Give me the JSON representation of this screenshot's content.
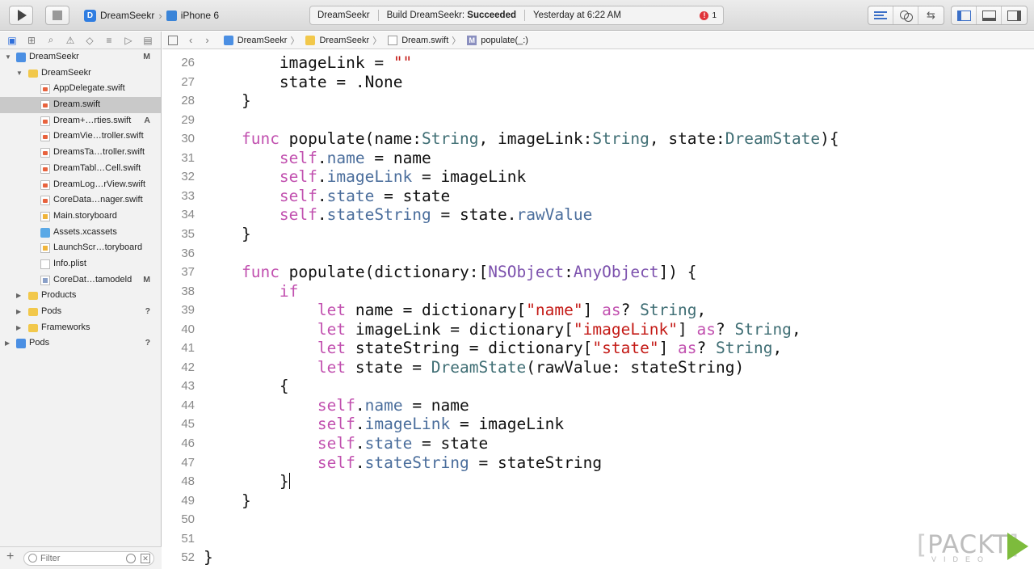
{
  "toolbar": {
    "scheme": {
      "app_icon": "D",
      "app": "DreamSeekr",
      "device": "iPhone 6"
    },
    "activity": {
      "project": "DreamSeekr",
      "build_label": "Build DreamSeekr:",
      "build_status": "Succeeded",
      "time": "Yesterday at 6:22 AM",
      "issues": "1"
    }
  },
  "navigator": {
    "tree": [
      {
        "label": "DreamSeekr",
        "badge": "M"
      },
      {
        "label": "DreamSeekr",
        "badge": ""
      },
      {
        "label": "AppDelegate.swift",
        "badge": ""
      },
      {
        "label": "Dream.swift",
        "badge": ""
      },
      {
        "label": "Dream+…rties.swift",
        "badge": "A"
      },
      {
        "label": "DreamVie…troller.swift",
        "badge": ""
      },
      {
        "label": "DreamsTa…troller.swift",
        "badge": ""
      },
      {
        "label": "DreamTabl…Cell.swift",
        "badge": ""
      },
      {
        "label": "DreamLog…rView.swift",
        "badge": ""
      },
      {
        "label": "CoreData…nager.swift",
        "badge": ""
      },
      {
        "label": "Main.storyboard",
        "badge": ""
      },
      {
        "label": "Assets.xcassets",
        "badge": ""
      },
      {
        "label": "LaunchScr…toryboard",
        "badge": ""
      },
      {
        "label": "Info.plist",
        "badge": ""
      },
      {
        "label": "CoreDat…tamodeld",
        "badge": "M"
      },
      {
        "label": "Products",
        "badge": ""
      },
      {
        "label": "Pods",
        "badge": "?"
      },
      {
        "label": "Frameworks",
        "badge": ""
      },
      {
        "label": "Pods",
        "badge": "?"
      }
    ],
    "filter_placeholder": "Filter"
  },
  "jumpbar": {
    "crumbs": [
      "DreamSeekr",
      "DreamSeekr",
      "Dream.swift",
      "populate(_:)"
    ],
    "method_icon": "M"
  },
  "editor": {
    "lines": [
      {
        "n": "26",
        "code": "        imageLink = \"\""
      },
      {
        "n": "27",
        "code": "        state = .None"
      },
      {
        "n": "28",
        "code": "    }"
      },
      {
        "n": "29",
        "code": ""
      },
      {
        "n": "30",
        "code": "    func populate(name:String, imageLink:String, state:DreamState){"
      },
      {
        "n": "31",
        "code": "        self.name = name"
      },
      {
        "n": "32",
        "code": "        self.imageLink = imageLink"
      },
      {
        "n": "33",
        "code": "        self.state = state"
      },
      {
        "n": "34",
        "code": "        self.stateString = state.rawValue"
      },
      {
        "n": "35",
        "code": "    }"
      },
      {
        "n": "36",
        "code": ""
      },
      {
        "n": "37",
        "code": "    func populate(dictionary:[NSObject:AnyObject]) {"
      },
      {
        "n": "38",
        "code": "        if"
      },
      {
        "n": "39",
        "code": "            let name = dictionary[\"name\"] as? String,"
      },
      {
        "n": "40",
        "code": "            let imageLink = dictionary[\"imageLink\"] as? String,"
      },
      {
        "n": "41",
        "code": "            let stateString = dictionary[\"state\"] as? String,"
      },
      {
        "n": "42",
        "code": "            let state = DreamState(rawValue: stateString)"
      },
      {
        "n": "43",
        "code": "        {"
      },
      {
        "n": "44",
        "code": "            self.name = name"
      },
      {
        "n": "45",
        "code": "            self.imageLink = imageLink"
      },
      {
        "n": "46",
        "code": "            self.state = state"
      },
      {
        "n": "47",
        "code": "            self.stateString = stateString"
      },
      {
        "n": "48",
        "code": "        }"
      },
      {
        "n": "49",
        "code": "    }"
      },
      {
        "n": "50",
        "code": ""
      },
      {
        "n": "51",
        "code": ""
      },
      {
        "n": "52",
        "code": "}"
      }
    ]
  },
  "watermark": {
    "word": "PACKT",
    "sub": "VIDEO"
  }
}
